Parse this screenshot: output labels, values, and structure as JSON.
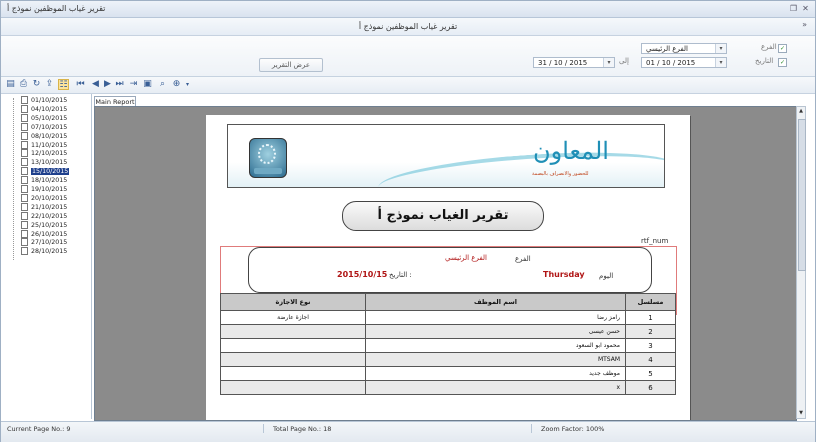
{
  "window": {
    "title": "تقرير غياب الموظفين نموذج أ",
    "controls": [
      "restore-icon",
      "close-icon"
    ]
  },
  "header": {
    "title": "تقرير غياب الموظفين نموذج أ",
    "collapse_glyph": "»"
  },
  "filters": {
    "branch_label": "الفرع",
    "branch_value": "الفرع الرئيسي",
    "date_label": "التاريخ",
    "from_date": "01 / 10 / 2015",
    "to_label": "إلى",
    "to_date": "31 / 10 / 2015",
    "show_report_label": "عرض التقرير",
    "checkbox_mark": "✓"
  },
  "toolbar": {
    "icons": [
      "open-icon",
      "print-icon",
      "refresh-icon",
      "tree-toggle-icon",
      "first-page-icon",
      "prev-page-icon",
      "next-page-icon",
      "last-page-icon",
      "export-icon",
      "stop-icon",
      "search-icon",
      "zoom-icon"
    ]
  },
  "sidebar": {
    "dates": [
      "01/10/2015",
      "04/10/2015",
      "05/10/2015",
      "07/10/2015",
      "08/10/2015",
      "11/10/2015",
      "12/10/2015",
      "13/10/2015",
      "15/10/2015",
      "18/10/2015",
      "19/10/2015",
      "20/10/2015",
      "21/10/2015",
      "22/10/2015",
      "25/10/2015",
      "26/10/2015",
      "27/10/2015",
      "28/10/2015"
    ],
    "selected": "15/10/2015"
  },
  "tabs": {
    "main_report": "Main Report"
  },
  "report": {
    "brand_name": "المعاون",
    "brand_subtitle": "للحضور والانصراف بالبصمة",
    "title": "تقرير الغياب نموذج أ",
    "rtf_label": "rtf_num",
    "branch_label": "الفرع",
    "branch_value": "الفرع الرئيسي",
    "day_label": "اليوم",
    "day_value": "Thursday",
    "date_label": "التاريخ :",
    "date_value": "2015/10/15",
    "columns": {
      "serial": "مسلسل",
      "employee_name": "اسم الموظف",
      "leave_type": "نوع الاجازة"
    },
    "rows": [
      {
        "serial": "1",
        "name": "رامز رضا",
        "leave": "اجازة عارضة"
      },
      {
        "serial": "2",
        "name": "حسن عيسى",
        "leave": ""
      },
      {
        "serial": "3",
        "name": "محمود ابو السعود",
        "leave": ""
      },
      {
        "serial": "4",
        "name": "MTSAM",
        "leave": ""
      },
      {
        "serial": "5",
        "name": "موظف جديد",
        "leave": ""
      },
      {
        "serial": "6",
        "name": "x",
        "leave": ""
      }
    ]
  },
  "status": {
    "current_page": "Current Page No.: 9",
    "total_pages": "Total Page No.: 18",
    "zoom": "Zoom Factor: 100%"
  },
  "colors": {
    "selection": "#1e3f8c",
    "brand": "#1f8fb6",
    "branch_text": "#b01515"
  }
}
